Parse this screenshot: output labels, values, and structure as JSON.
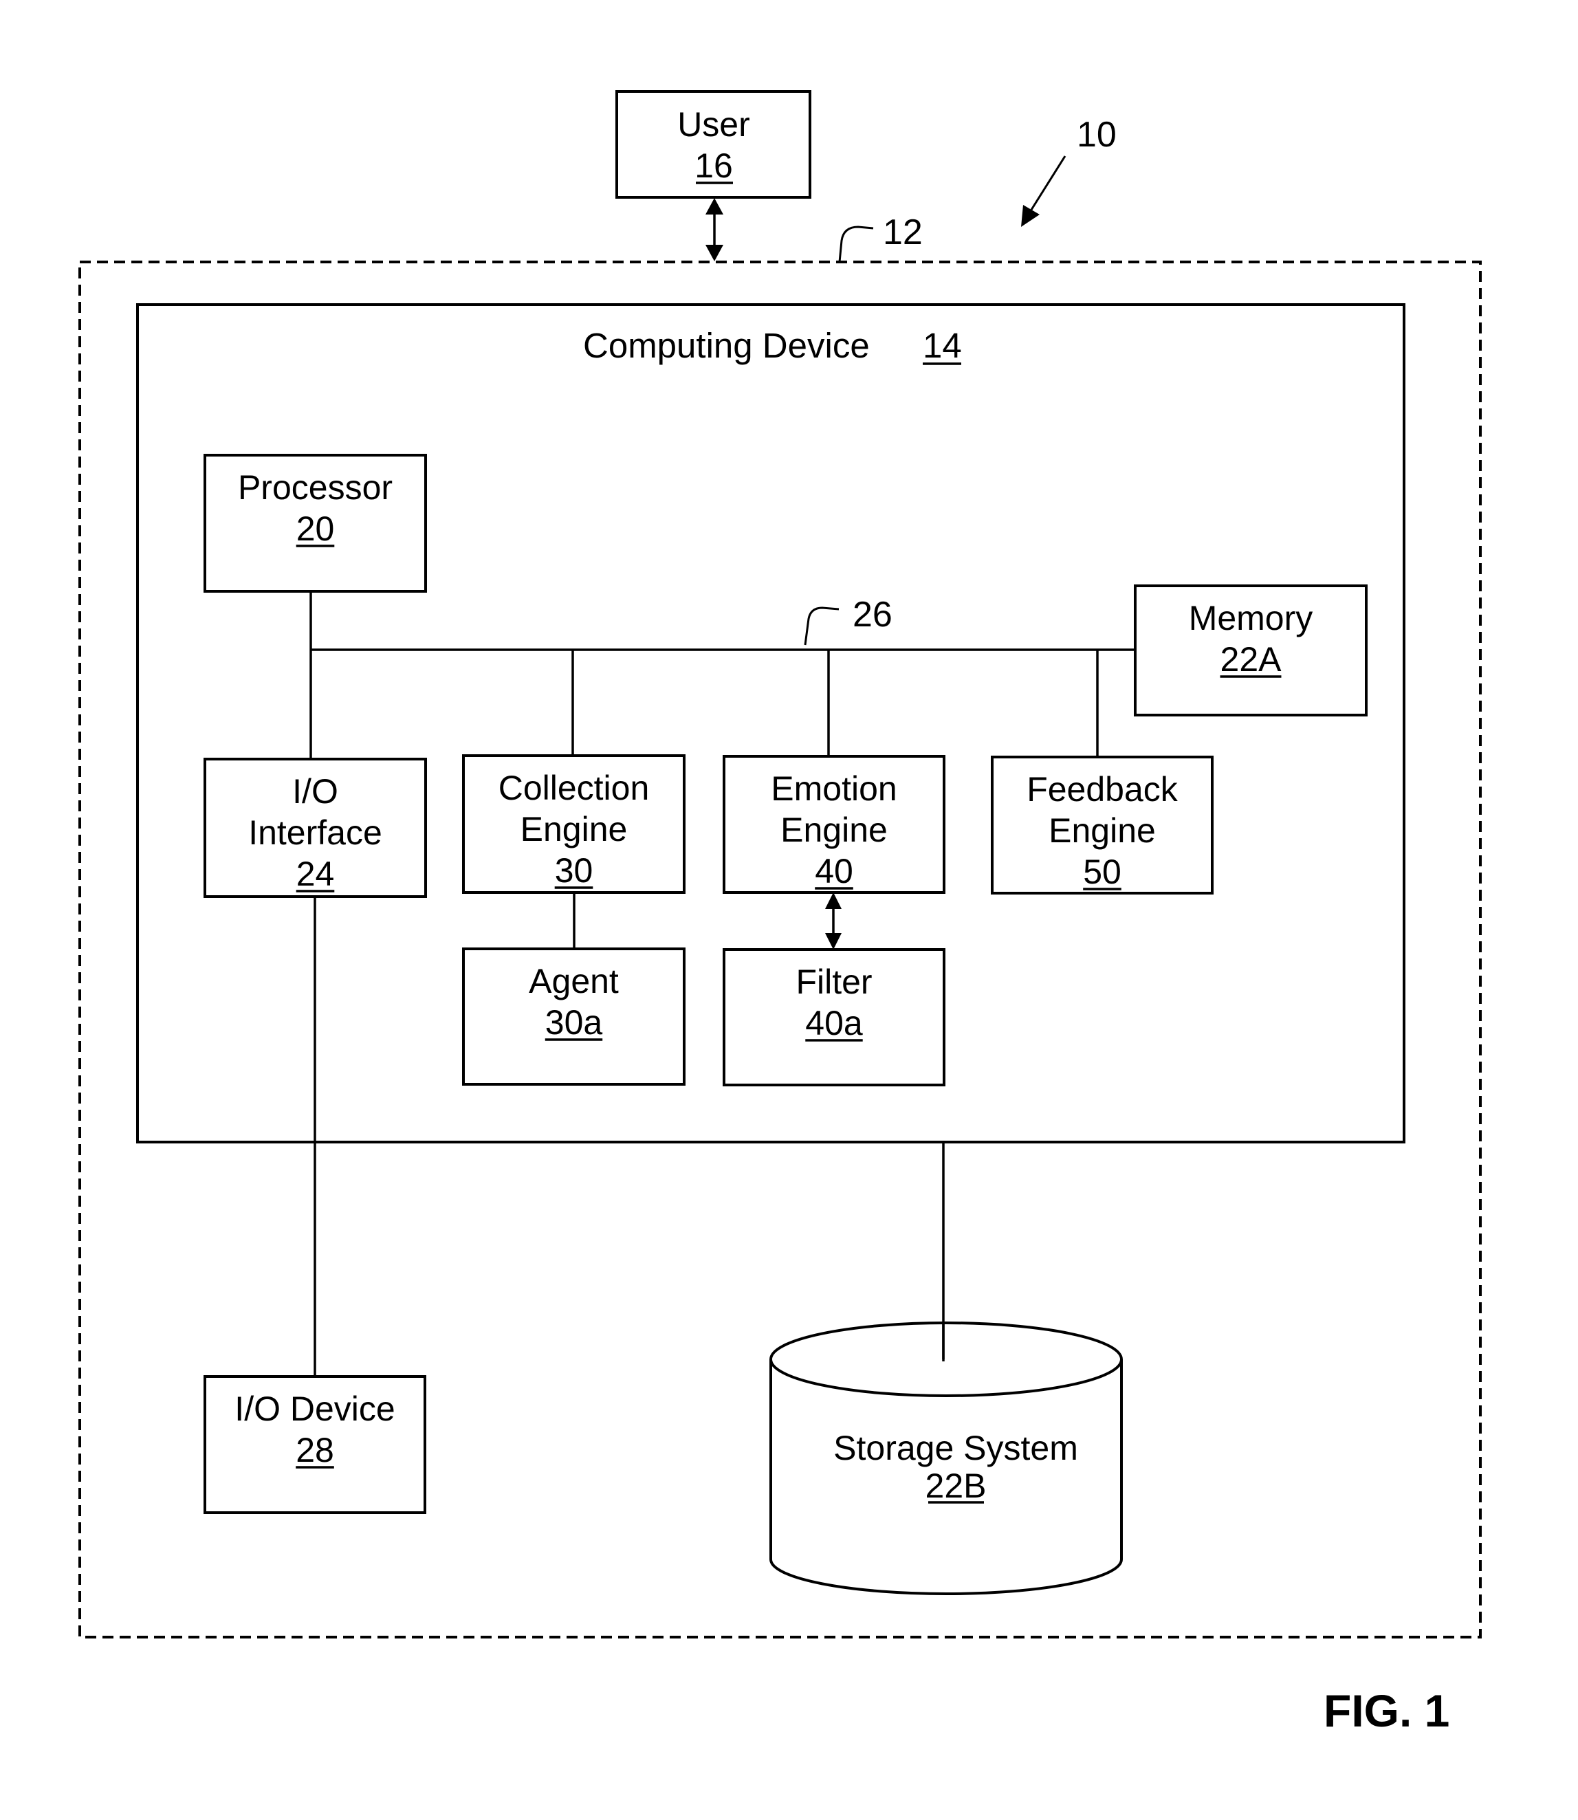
{
  "figure": {
    "label": "FIG. 1",
    "system_ref": "10",
    "environment_ref": "12",
    "bus_ref": "26"
  },
  "user": {
    "label": "User",
    "ref": "16"
  },
  "computing_device": {
    "label": "Computing Device",
    "ref": "14"
  },
  "components": {
    "processor": {
      "lines": [
        "Processor"
      ],
      "ref": "20"
    },
    "memory": {
      "lines": [
        "Memory"
      ],
      "ref": "22A"
    },
    "io_interface": {
      "lines": [
        "I/O",
        "Interface"
      ],
      "ref": "24"
    },
    "collection_engine": {
      "lines": [
        "Collection",
        "Engine"
      ],
      "ref": "30"
    },
    "emotion_engine": {
      "lines": [
        "Emotion",
        "Engine"
      ],
      "ref": "40"
    },
    "feedback_engine": {
      "lines": [
        "Feedback",
        "Engine"
      ],
      "ref": "50"
    },
    "agent": {
      "lines": [
        "Agent"
      ],
      "ref": "30a"
    },
    "filter": {
      "lines": [
        "Filter"
      ],
      "ref": "40a"
    },
    "io_device": {
      "lines": [
        "I/O Device"
      ],
      "ref": "28"
    },
    "storage_system": {
      "lines": [
        "Storage System"
      ],
      "ref": "22B"
    }
  }
}
